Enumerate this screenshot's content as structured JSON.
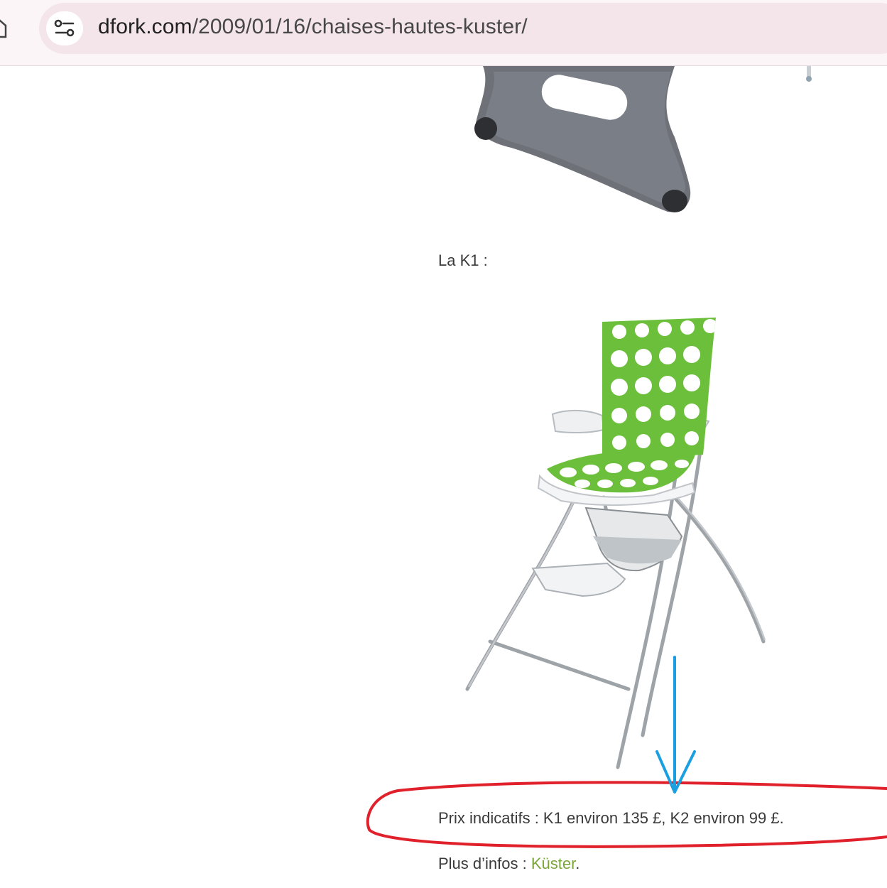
{
  "browser": {
    "url_domain": "dfork.com",
    "url_path": "/2009/01/16/chaises-hautes-kuster/"
  },
  "article": {
    "k1_label": "La K1 :",
    "prices": "Prix indicatifs : K1 environ 135 £, K2 environ 99 £.",
    "more_info_prefix": "Plus d’infos : ",
    "more_info_link": "Küster",
    "more_info_suffix": "."
  },
  "colors": {
    "link": "#7aa53a",
    "annotation_circle": "#e0202a",
    "annotation_arrow": "#1a9fe0",
    "chair_cushion": "#6cbf3a"
  }
}
